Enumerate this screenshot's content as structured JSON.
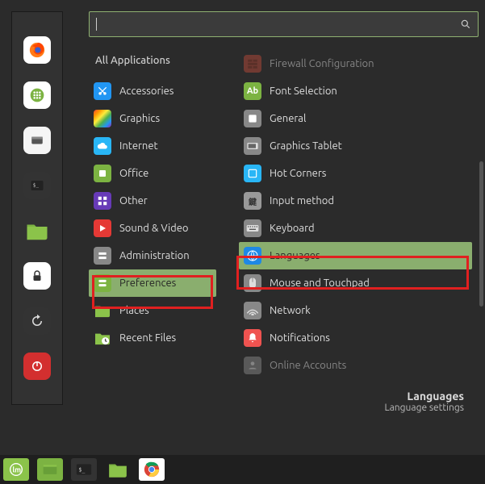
{
  "search": {
    "placeholder": ""
  },
  "left": {
    "header": "All Applications",
    "items": [
      {
        "label": "Accessories",
        "icon": "scissors"
      },
      {
        "label": "Graphics",
        "icon": "rainbow"
      },
      {
        "label": "Internet",
        "icon": "cloud"
      },
      {
        "label": "Office",
        "icon": "office"
      },
      {
        "label": "Other",
        "icon": "grid"
      },
      {
        "label": "Sound & Video",
        "icon": "play"
      },
      {
        "label": "Administration",
        "icon": "admin"
      },
      {
        "label": "Preferences",
        "icon": "prefs",
        "selected": true,
        "highlight": true
      },
      {
        "label": "Places",
        "icon": "folder"
      },
      {
        "label": "Recent Files",
        "icon": "recent"
      }
    ]
  },
  "right": {
    "items": [
      {
        "label": "Firewall Configuration",
        "icon": "firewall",
        "faded": true
      },
      {
        "label": "Font Selection",
        "icon": "font"
      },
      {
        "label": "General",
        "icon": "general"
      },
      {
        "label": "Graphics Tablet",
        "icon": "tablet"
      },
      {
        "label": "Hot Corners",
        "icon": "corners"
      },
      {
        "label": "Input method",
        "icon": "input"
      },
      {
        "label": "Keyboard",
        "icon": "keyboard"
      },
      {
        "label": "Languages",
        "icon": "globe",
        "selected": true,
        "highlight": true
      },
      {
        "label": "Mouse and Touchpad",
        "icon": "mouse"
      },
      {
        "label": "Network",
        "icon": "network"
      },
      {
        "label": "Notifications",
        "icon": "bell"
      },
      {
        "label": "Online Accounts",
        "icon": "online",
        "faded": true
      }
    ]
  },
  "footer": {
    "title": "Languages",
    "sub": "Language settings"
  },
  "launcher": [
    "firefox",
    "apps",
    "files-white",
    "terminal",
    "folder-green",
    "lock",
    "updates",
    "power"
  ],
  "taskbar": [
    "mint",
    "files-green",
    "terminal-dark",
    "folder-green",
    "chrome"
  ]
}
